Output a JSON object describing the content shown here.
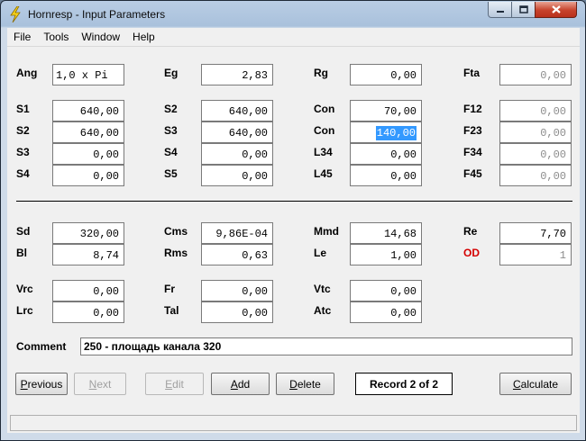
{
  "window": {
    "title": "Hornresp - Input Parameters"
  },
  "menu": [
    "File",
    "Tools",
    "Window",
    "Help"
  ],
  "fields": {
    "ang": {
      "label": "Ang",
      "value": "1,0 x Pi"
    },
    "eg": {
      "label": "Eg",
      "value": "2,83"
    },
    "rg": {
      "label": "Rg",
      "value": "0,00"
    },
    "fta": {
      "label": "Fta",
      "value": "0,00"
    },
    "s1": {
      "label": "S1",
      "value": "640,00"
    },
    "s2a": {
      "label": "S2",
      "value": "640,00"
    },
    "con1": {
      "label": "Con",
      "value": "70,00"
    },
    "f12": {
      "label": "F12",
      "value": "0,00"
    },
    "s2b": {
      "label": "S2",
      "value": "640,00"
    },
    "s3a": {
      "label": "S3",
      "value": "640,00"
    },
    "con2": {
      "label": "Con",
      "value": "140,00"
    },
    "f23": {
      "label": "F23",
      "value": "0,00"
    },
    "s3b": {
      "label": "S3",
      "value": "0,00"
    },
    "s4a": {
      "label": "S4",
      "value": "0,00"
    },
    "l34": {
      "label": "L34",
      "value": "0,00"
    },
    "f34": {
      "label": "F34",
      "value": "0,00"
    },
    "s4b": {
      "label": "S4",
      "value": "0,00"
    },
    "s5": {
      "label": "S5",
      "value": "0,00"
    },
    "l45": {
      "label": "L45",
      "value": "0,00"
    },
    "f45": {
      "label": "F45",
      "value": "0,00"
    },
    "sd": {
      "label": "Sd",
      "value": "320,00"
    },
    "cms": {
      "label": "Cms",
      "value": "9,86E-04"
    },
    "mmd": {
      "label": "Mmd",
      "value": "14,68"
    },
    "re": {
      "label": "Re",
      "value": "7,70"
    },
    "bl": {
      "label": "Bl",
      "value": "8,74"
    },
    "rms": {
      "label": "Rms",
      "value": "0,63"
    },
    "le": {
      "label": "Le",
      "value": "1,00"
    },
    "od": {
      "label": "OD",
      "value": "1"
    },
    "vrc": {
      "label": "Vrc",
      "value": "0,00"
    },
    "fr": {
      "label": "Fr",
      "value": "0,00"
    },
    "vtc": {
      "label": "Vtc",
      "value": "0,00"
    },
    "lrc": {
      "label": "Lrc",
      "value": "0,00"
    },
    "tal": {
      "label": "Tal",
      "value": "0,00"
    },
    "atc": {
      "label": "Atc",
      "value": "0,00"
    }
  },
  "comment": {
    "label": "Comment",
    "value": "250 - площадь канала 320"
  },
  "buttons": {
    "previous": {
      "pre": "",
      "ul": "P",
      "post": "revious"
    },
    "next": {
      "pre": "",
      "ul": "N",
      "post": "ext"
    },
    "edit": {
      "pre": "",
      "ul": "E",
      "post": "dit"
    },
    "add": {
      "pre": "",
      "ul": "A",
      "post": "dd"
    },
    "delete": {
      "pre": "",
      "ul": "D",
      "post": "elete"
    },
    "calculate": {
      "pre": "",
      "ul": "C",
      "post": "alculate"
    }
  },
  "record": "Record 2 of 2",
  "colors": {
    "od_label": "#d40000",
    "selection": "#3399ff"
  }
}
